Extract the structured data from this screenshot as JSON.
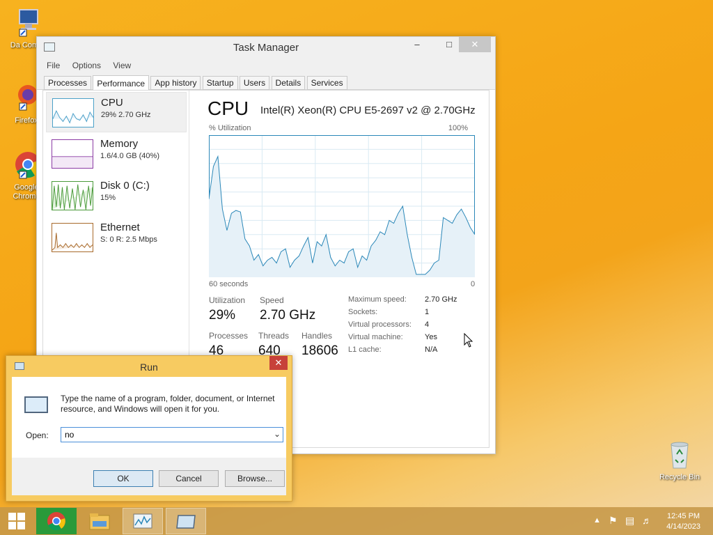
{
  "desktop": {
    "icons": [
      {
        "label": "Da Comp"
      },
      {
        "label": "Firefox"
      },
      {
        "label": "Google Chrome"
      },
      {
        "label": "Recycle Bin"
      }
    ]
  },
  "task_manager": {
    "title": "Task Manager",
    "menu": [
      "File",
      "Options",
      "View"
    ],
    "tabs": [
      "Processes",
      "Performance",
      "App history",
      "Startup",
      "Users",
      "Details",
      "Services"
    ],
    "active_tab": "Performance",
    "sidebar": [
      {
        "name": "CPU",
        "value": "29% 2.70 GHz",
        "color": "#4a9fc8"
      },
      {
        "name": "Memory",
        "value": "1.6/4.0 GB (40%)",
        "color": "#8b3aa4"
      },
      {
        "name": "Disk 0 (C:)",
        "value": "15%",
        "color": "#4a9a3a"
      },
      {
        "name": "Ethernet",
        "value": "S: 0 R: 2.5 Mbps",
        "color": "#a8692a"
      }
    ],
    "cpu": {
      "title": "CPU",
      "model": "Intel(R) Xeon(R) CPU E5-2697 v2 @ 2.70GHz",
      "y_label": "% Utilization",
      "y_max_label": "100%",
      "x_left_label": "60 seconds",
      "x_right_label": "0",
      "stats": {
        "utilization_label": "Utilization",
        "utilization": "29%",
        "speed_label": "Speed",
        "speed": "2.70 GHz",
        "processes_label": "Processes",
        "processes": "46",
        "threads_label": "Threads",
        "threads": "640",
        "handles_label": "Handles",
        "handles": "18606"
      },
      "details": [
        {
          "label": "Maximum speed:",
          "value": "2.70 GHz"
        },
        {
          "label": "Sockets:",
          "value": "1"
        },
        {
          "label": "Virtual processors:",
          "value": "4"
        },
        {
          "label": "Virtual machine:",
          "value": "Yes"
        },
        {
          "label": "L1 cache:",
          "value": "N/A"
        }
      ]
    }
  },
  "chart_data": {
    "type": "area",
    "title": "",
    "xlabel": "",
    "ylabel": "% Utilization",
    "ylim": [
      0,
      100
    ],
    "xlim": [
      60,
      0
    ],
    "series": [
      {
        "values": [
          55,
          78,
          85,
          48,
          33,
          45,
          47,
          46,
          27,
          22,
          12,
          16,
          8,
          12,
          14,
          10,
          18,
          20,
          7,
          12,
          15,
          22,
          28,
          10,
          25,
          22,
          30,
          14,
          8,
          12,
          10,
          18,
          20,
          7,
          15,
          12,
          22,
          26,
          32,
          30,
          40,
          38,
          45,
          50,
          30,
          14,
          2,
          2,
          2,
          5,
          10,
          12,
          42,
          40,
          38,
          44,
          48,
          42,
          35,
          30
        ]
      }
    ]
  },
  "run_dialog": {
    "title": "Run",
    "description": "Type the name of a program, folder, document, or Internet resource, and Windows will open it for you.",
    "open_label": "Open:",
    "open_value": "no",
    "ok": "OK",
    "cancel": "Cancel",
    "browse": "Browse..."
  },
  "taskbar": {
    "time": "12:45 PM",
    "date": "4/14/2023"
  }
}
